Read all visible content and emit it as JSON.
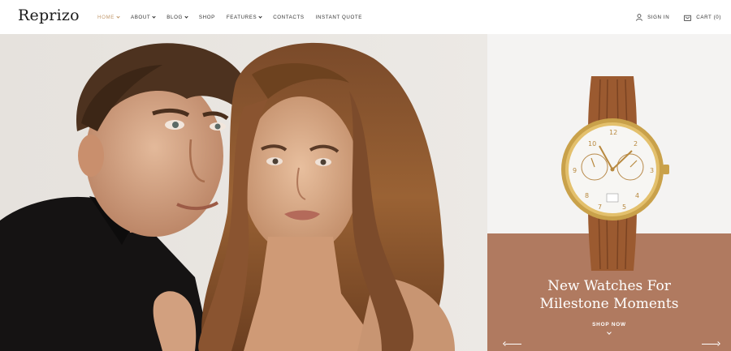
{
  "brand": {
    "name": "Reprizo"
  },
  "nav": {
    "items": [
      {
        "label": "HOME",
        "has_dropdown": true,
        "active": true
      },
      {
        "label": "ABOUT",
        "has_dropdown": true,
        "active": false
      },
      {
        "label": "BLOG",
        "has_dropdown": true,
        "active": false
      },
      {
        "label": "SHOP",
        "has_dropdown": false,
        "active": false
      },
      {
        "label": "FEATURES",
        "has_dropdown": true,
        "active": false
      },
      {
        "label": "CONTACTS",
        "has_dropdown": false,
        "active": false
      },
      {
        "label": "INSTANT QUOTE",
        "has_dropdown": false,
        "active": false
      }
    ]
  },
  "tools": {
    "sign_in": "SIGN IN",
    "cart": "CART (0)"
  },
  "hero": {
    "image": "couple-portrait-image"
  },
  "promo": {
    "image": "gold-watch-image",
    "title_line1": "New Watches For",
    "title_line2": "Milestone Moments",
    "cta": "SHOP NOW"
  },
  "colors": {
    "accent": "#c29a6e",
    "promo_bg": "#b07a60",
    "hero_bg": "#e9e6e2"
  }
}
